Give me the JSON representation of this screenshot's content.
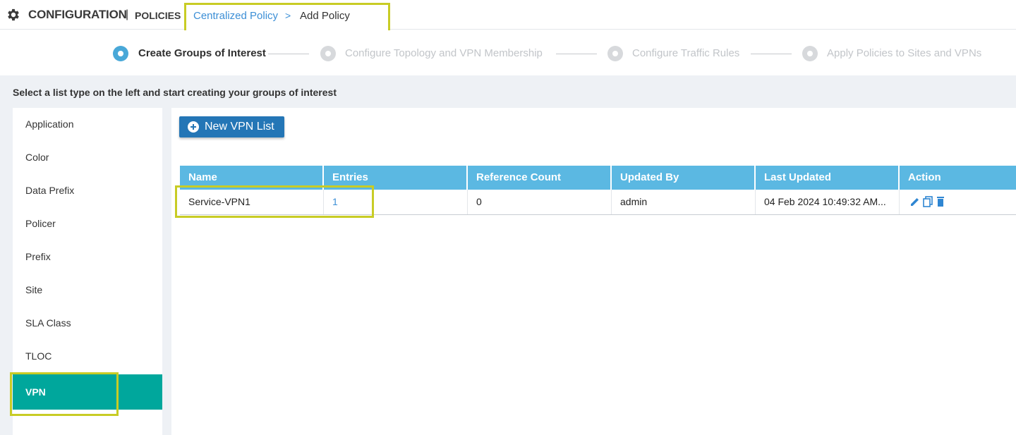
{
  "header": {
    "title": "CONFIGURATION",
    "separator": "|",
    "subtitle": "POLICIES",
    "breadcrumb_link": "Centralized Policy",
    "breadcrumb_arrow": ">",
    "breadcrumb_current": "Add Policy",
    "gear_icon": "gear-icon"
  },
  "steps": [
    {
      "label": "Create Groups of Interest",
      "active": true
    },
    {
      "label": "Configure Topology and VPN Membership",
      "active": false
    },
    {
      "label": "Configure Traffic Rules",
      "active": false
    },
    {
      "label": "Apply Policies to Sites and VPNs",
      "active": false
    }
  ],
  "instruction": "Select a list type on the left and start creating your groups of interest",
  "sidebar": {
    "items": [
      {
        "label": "Application"
      },
      {
        "label": "Color"
      },
      {
        "label": "Data Prefix"
      },
      {
        "label": "Policer"
      },
      {
        "label": "Prefix"
      },
      {
        "label": "Site"
      },
      {
        "label": "SLA Class"
      },
      {
        "label": "TLOC"
      },
      {
        "label": "VPN"
      }
    ],
    "selected": "VPN"
  },
  "new_button": {
    "label": "New VPN List",
    "icon": "plus-circle-icon"
  },
  "table": {
    "headers": [
      "Name",
      "Entries",
      "Reference Count",
      "Updated By",
      "Last Updated",
      "Action"
    ],
    "rows": [
      {
        "name": "Service-VPN1",
        "entries": "1",
        "reference_count": "0",
        "updated_by": "admin",
        "last_updated": "04 Feb 2024 10:49:32 AM..."
      }
    ],
    "action_icons": [
      "edit-icon",
      "copy-icon",
      "delete-icon"
    ]
  },
  "colors": {
    "accent": "#49a8d8",
    "selected_teal": "#00a79c",
    "button_blue": "#2476b6",
    "table_header": "#5bb8e2",
    "link": "#3c8fd6",
    "highlight": "#c8cc25"
  }
}
